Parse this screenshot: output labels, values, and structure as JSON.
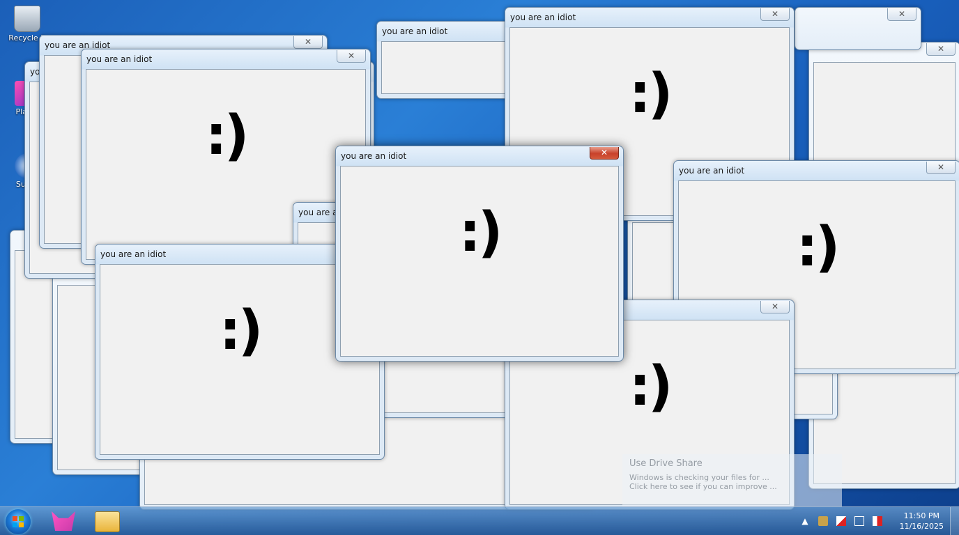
{
  "desktop_icons": [
    {
      "label": "Recycle B",
      "icon": "recycle-bin-icon"
    },
    {
      "label": "Plasm",
      "icon": "plasma-app-icon"
    },
    {
      "label": "Super",
      "icon": "super-app-icon"
    }
  ],
  "popup": {
    "title": "you are an idiot",
    "close_glyph": "✕",
    "smiley": ":)"
  },
  "notification": {
    "title": "Use Drive Share",
    "line1": "Windows is checking your files for ...",
    "line2": "Click here to see if you can improve ..."
  },
  "taskbar": {
    "start_icon": "windows-start-icon",
    "pinned": [
      {
        "name": "fox-browser-icon"
      },
      {
        "name": "file-explorer-icon"
      }
    ],
    "tray": {
      "expand_glyph": "▲",
      "clock_time": "11:50 PM",
      "clock_date": "11/16/2025"
    }
  }
}
